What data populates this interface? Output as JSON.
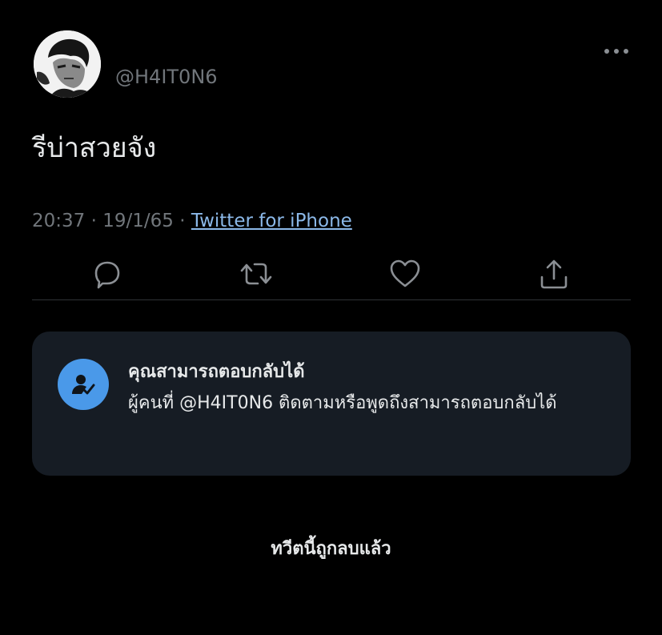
{
  "tweet": {
    "handle": "@H4IT0N6",
    "text": "รีบ่าสวยจัง",
    "time": "20:37",
    "separator": "·",
    "date": "19/1/65",
    "source": "Twitter for iPhone"
  },
  "actions": {
    "reply_icon": "reply-icon",
    "retweet_icon": "retweet-icon",
    "like_icon": "heart-icon",
    "share_icon": "share-icon",
    "more_icon": "more-icon"
  },
  "reply_settings": {
    "title": "คุณสามารถตอบกลับได้",
    "description": "ผู้คนที่ @H4IT0N6 ติดตามหรือพูดถึงสามารถตอบกลับได้",
    "icon": "user-check-icon"
  },
  "deleted_notice": "ทวีตนี้ถูกลบแล้ว",
  "colors": {
    "background": "#000000",
    "text": "#e7e9ea",
    "muted": "#71767b",
    "link": "#8bb8e8",
    "card": "#161c24",
    "accent": "#4a99e9"
  }
}
